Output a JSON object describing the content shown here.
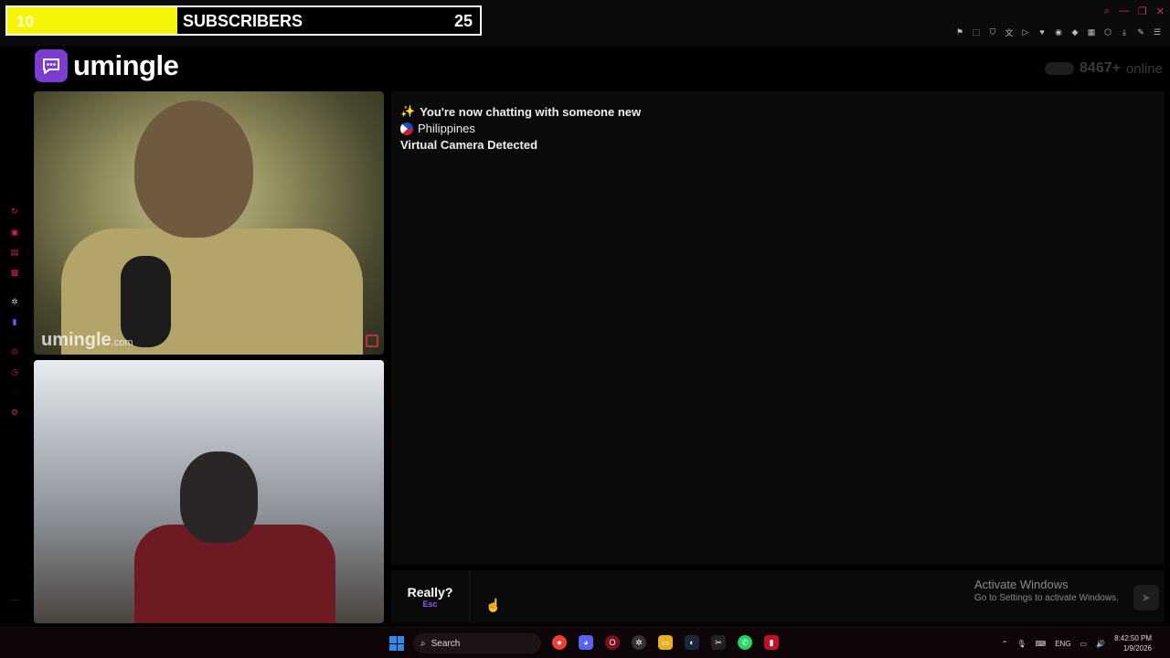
{
  "overlay": {
    "start_count": "10",
    "label": "SUBSCRIBERS",
    "goal_count": "25",
    "progress": 0.36,
    "fill_color": "#f5f50a"
  },
  "app": {
    "name": "umingle",
    "online_count": "8467+",
    "online_word": "online",
    "accent_color": "#7d3cd1"
  },
  "video": {
    "watermark_main": "umingle",
    "watermark_suffix": ".com"
  },
  "chat": {
    "messages": [
      {
        "icon": "sparkles-icon",
        "text": "You're now chatting with someone new"
      },
      {
        "icon": "philippines-flag-icon",
        "text": "Philippines"
      },
      {
        "icon": "",
        "text": "Virtual Camera Detected"
      }
    ]
  },
  "input": {
    "esc_label": "Really?",
    "esc_key": "Esc"
  },
  "watermark_os": {
    "title": "Activate Windows",
    "subtitle": "Go to Settings to activate Windows."
  },
  "taskbar": {
    "search_label": "Search",
    "language": "ENG",
    "time": "8:42:50 PM",
    "date": "1/9/2026"
  }
}
